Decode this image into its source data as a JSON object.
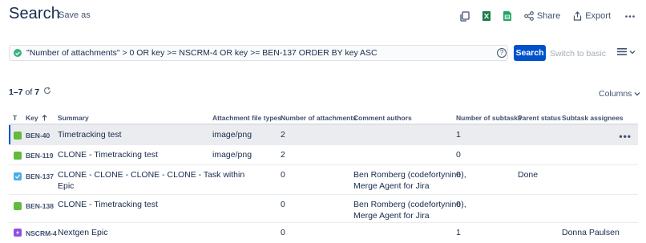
{
  "header": {
    "title": "Search",
    "save_as": "Save as"
  },
  "toolbar": {
    "share_label": "Share",
    "export_label": "Export",
    "more_icon": "more-icon"
  },
  "search": {
    "query": "\"Number of attachments\" > 0 OR key >= NSCRM-4 OR key >= BEN-137 ORDER BY key ASC",
    "search_label": "Search",
    "switch_label": "Switch to basic",
    "help_symbol": "?"
  },
  "results": {
    "count_range": "1–7",
    "count_of": "of",
    "count_total": "7",
    "columns_label": "Columns"
  },
  "table": {
    "headers": {
      "type": "T",
      "key": "Key",
      "summary": "Summary",
      "attachment_types": "Attachment file types",
      "attachments": "Number of attachments",
      "comment_authors": "Comment authors",
      "subtasks": "Number of subtasks",
      "parent_status": "Parent status",
      "subtask_assignees": "Subtask assignees"
    },
    "rows": [
      {
        "type": "story",
        "key": "BEN-40",
        "summary": "Timetracking test",
        "attachment_types": "image/png",
        "attachments": "2",
        "comment_authors_1": "",
        "comment_authors_2": "",
        "subtasks": "1",
        "parent_status": "",
        "subtask_assignees": ""
      },
      {
        "type": "story",
        "key": "BEN-119",
        "summary": "CLONE - Timetracking test",
        "attachment_types": "image/png",
        "attachments": "2",
        "comment_authors_1": "",
        "comment_authors_2": "",
        "subtasks": "0",
        "parent_status": "",
        "subtask_assignees": ""
      },
      {
        "type": "task",
        "key": "BEN-137",
        "summary_1": "CLONE - CLONE - CLONE - CLONE - Task within",
        "summary_2": "Epic",
        "attachment_types": "",
        "attachments": "0",
        "comment_authors_1": "Ben Romberg (codefortynine),",
        "comment_authors_2": "Merge Agent for Jira",
        "subtasks": "0",
        "parent_status": "Done",
        "subtask_assignees": ""
      },
      {
        "type": "story",
        "key": "BEN-138",
        "summary": "CLONE - Timetracking test",
        "attachment_types": "",
        "attachments": "0",
        "comment_authors_1": "Ben Romberg (codefortynine),",
        "comment_authors_2": "Merge Agent for Jira",
        "subtasks": "0",
        "parent_status": "",
        "subtask_assignees": ""
      },
      {
        "type": "epic",
        "key": "NSCRM-4",
        "summary": "Nextgen Epic",
        "attachment_types": "",
        "attachments": "0",
        "comment_authors_1": "",
        "comment_authors_2": "",
        "subtasks": "1",
        "parent_status": "",
        "subtask_assignees": "Donna Paulsen"
      }
    ],
    "row_actions": "•••"
  },
  "colors": {
    "primary": "#0052cc",
    "success": "#36b37e",
    "story": "#63ba3c",
    "task": "#4bade8",
    "epic": "#904ee2",
    "selected_row": "#ebecf0"
  }
}
